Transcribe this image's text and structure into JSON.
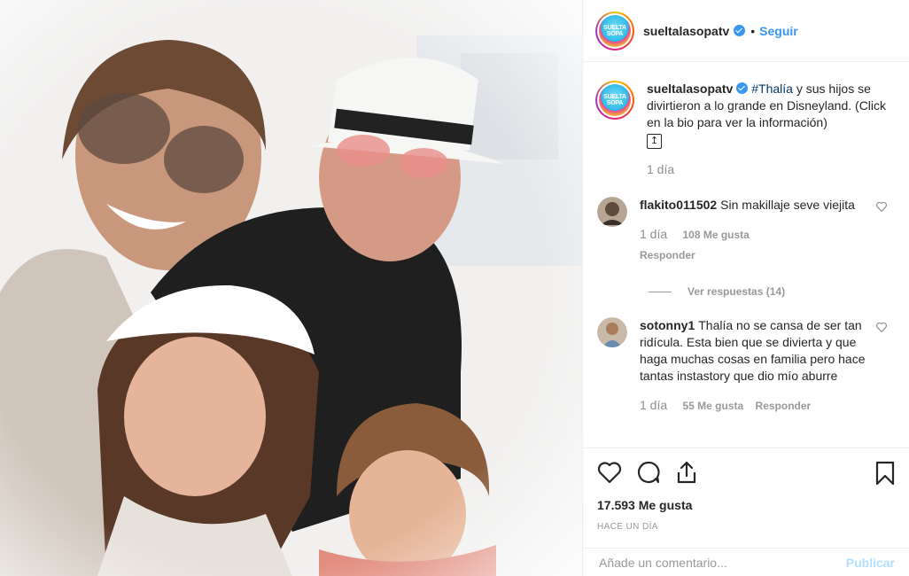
{
  "photo": {
    "alt_icon": "family-selfie-photo"
  },
  "header": {
    "logo_line1": "SUELTA",
    "logo_line2": "SOPA",
    "username": "sueltalasopatv",
    "separator": "•",
    "follow_label": "Seguir"
  },
  "caption": {
    "username": "sueltalasopatv",
    "hashtag": "#Thalía",
    "text": " y sus hijos se divirtieron a lo grande en Disneyland. (Click en la bio para ver la información)",
    "icon_glyph": "↥",
    "age": "1 día"
  },
  "comments": [
    {
      "username": "flakito011502",
      "text": "Sin makillaje seve viejita",
      "age": "1 día",
      "likes": "108 Me gusta",
      "reply_label": "Responder",
      "view_replies": "Ver respuestas (14)"
    },
    {
      "username": "sotonny1",
      "text": "Thalía no se cansa de ser tan ridícula. Esta bien que se divierta y que haga muchas cosas en familia pero hace tantas instastory que dio mío aburre",
      "age": "1 día",
      "likes": "55 Me gusta",
      "reply_label": "Responder"
    }
  ],
  "actions": {
    "likes_count": "17.593 Me gusta",
    "time_ago": "HACE UN DÍA"
  },
  "add_comment": {
    "placeholder": "Añade un comentario...",
    "publish_label": "Publicar"
  },
  "colors": {
    "accent": "#3897f0",
    "publish_disabled": "#b2dffc",
    "muted": "#999999"
  }
}
